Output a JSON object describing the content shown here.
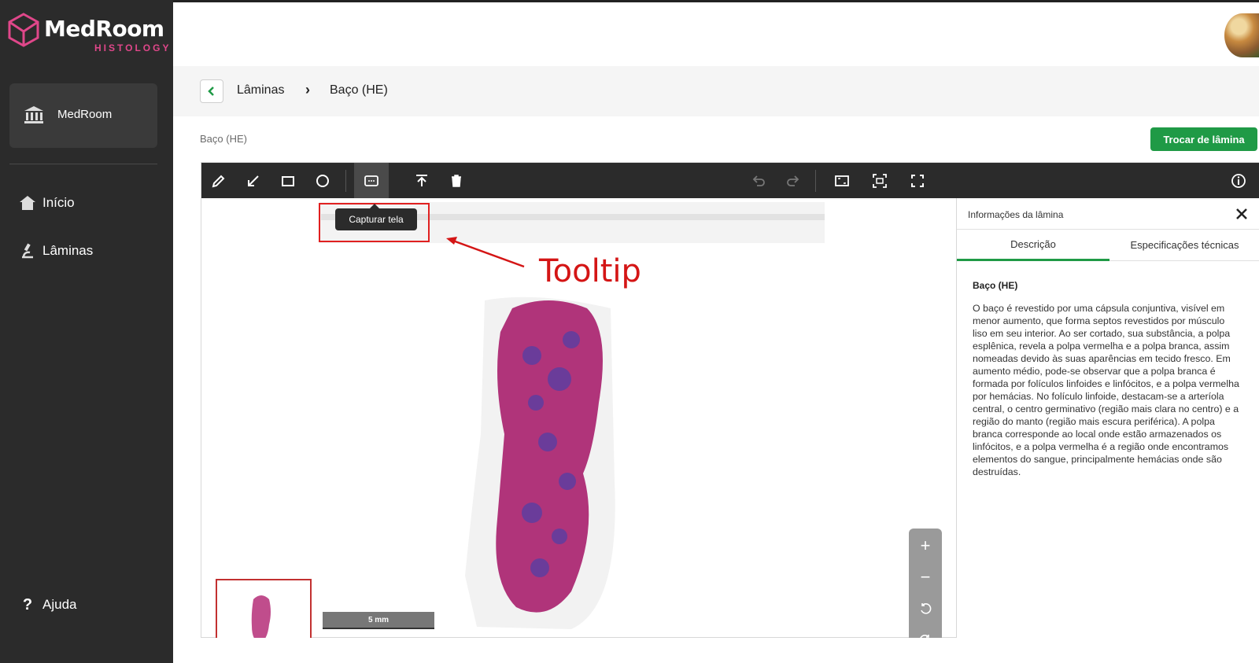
{
  "sidebar": {
    "brand": "MedRoom",
    "brand_sub": "HISTOLOGY",
    "org_label": "MedRoom",
    "items": [
      {
        "label": "Início"
      },
      {
        "label": "Lâminas"
      }
    ],
    "help_label": "Ajuda"
  },
  "breadcrumb": {
    "items": [
      "Lâminas",
      "Baço (HE)"
    ]
  },
  "slide": {
    "name": "Baço (HE)",
    "swap_button": "Trocar de lâmina"
  },
  "toolbar": {
    "tooltip": "Capturar tela",
    "icons": [
      "pencil-icon",
      "arrow-icon",
      "rectangle-icon",
      "circle-icon",
      "screenshot-icon",
      "export-icon",
      "trash-icon",
      "undo-icon",
      "redo-icon",
      "fit-icon",
      "focus-icon",
      "fullscreen-icon",
      "info-icon"
    ]
  },
  "annotation": {
    "label": "Tooltip",
    "color": "#d41515"
  },
  "viewer": {
    "scale_label": "5 mm",
    "zoom_controls": [
      "+",
      "−",
      "rotate-left-icon",
      "rotate-right-icon"
    ]
  },
  "info_panel": {
    "title": "Informações da lâmina",
    "tabs": [
      "Descrição",
      "Especificações técnicas"
    ],
    "active_tab": "Descrição",
    "heading": "Baço (HE)",
    "description": "O baço é revestido por uma cápsula conjuntiva, visível em menor aumento, que forma septos revestidos por músculo liso em seu interior. Ao ser cortado, sua substância, a polpa esplênica, revela a polpa vermelha e a polpa branca, assim nomeadas devido às suas aparências em tecido fresco. Em aumento médio, pode-se observar que a polpa branca é formada por folículos linfoides e linfócitos, e a polpa vermelha por hemácias. No folículo linfoide, destacam-se a arteríola central, o centro germinativo (região mais clara no centro) e a região do manto (região mais escura periférica). A polpa branca corresponde ao local onde estão armazenados os linfócitos, e a polpa vermelha é a região onde encontramos elementos do sangue, principalmente hemácias onde são destruídas."
  },
  "colors": {
    "sidebar_bg": "#2b2b2b",
    "accent_green": "#1f9a46",
    "brand_pink": "#e0478a"
  }
}
